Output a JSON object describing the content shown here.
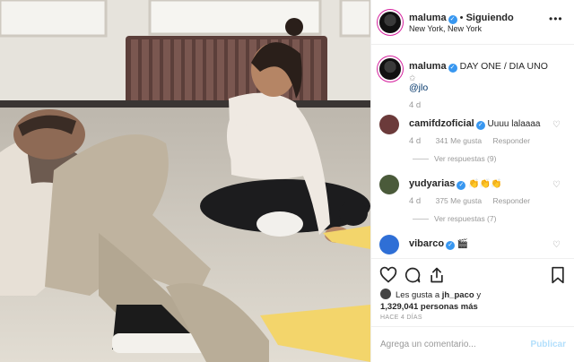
{
  "post": {
    "username": "maluma",
    "verified_mark": "✓",
    "separator": "•",
    "follow_status": "Siguiendo",
    "location": "New York, New York",
    "more_icon": "more-dots-icon"
  },
  "caption": {
    "username": "maluma",
    "text": "DAY ONE / DIA UNO",
    "emoji_line": "✩",
    "mention": "@jlo",
    "age": "4 d"
  },
  "comments": [
    {
      "username": "camifdzoficial",
      "verified": true,
      "text": "Uuuu lalaaaa",
      "age": "4 d",
      "likes": "341 Me gusta",
      "reply": "Responder",
      "replies": "Ver respuestas (9)",
      "avatar_color": "#6b3a3a"
    },
    {
      "username": "yudyarias",
      "verified": true,
      "text": "👏👏👏",
      "age": "4 d",
      "likes": "375 Me gusta",
      "reply": "Responder",
      "replies": "Ver respuestas (7)",
      "avatar_color": "#4a5a3a"
    },
    {
      "username": "vibarco",
      "verified": true,
      "text": "🎬",
      "age": "",
      "likes": "",
      "reply": "",
      "replies": "",
      "avatar_color": "#2f6fd6"
    }
  ],
  "actions": {
    "like_icon": "heart-icon",
    "comment_icon": "comment-icon",
    "share_icon": "share-icon",
    "save_icon": "bookmark-icon"
  },
  "likes": {
    "prefix": "Les gusta a",
    "user": "jh_paco",
    "conj": "y",
    "count": "1,329,041 personas más"
  },
  "posted_ago": "HACE 4 DÍAS",
  "add_comment": {
    "placeholder": "Agrega un comentario...",
    "publish": "Publicar"
  },
  "colors": {
    "verified": "#3897f0",
    "link": "#003569",
    "muted": "#999999",
    "publish_disabled": "#b2dffc"
  }
}
